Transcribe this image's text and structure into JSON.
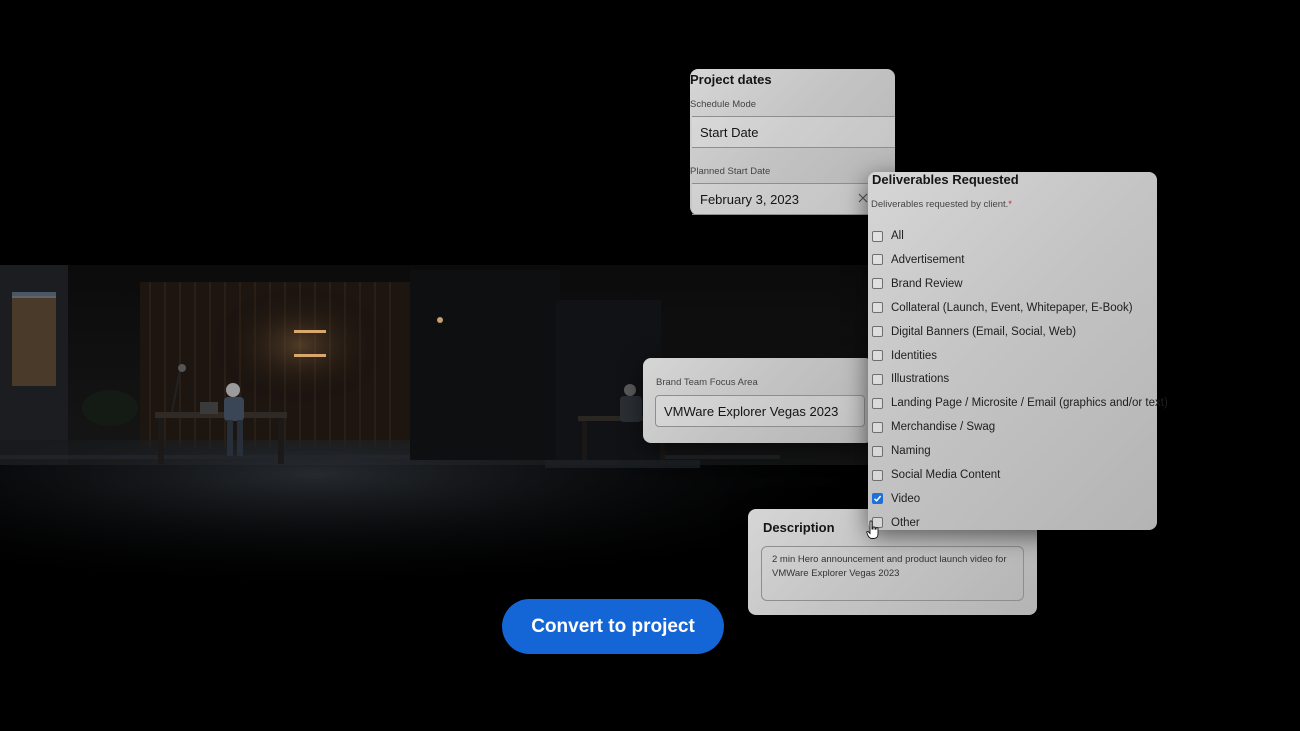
{
  "project_dates": {
    "title": "Project dates",
    "schedule_mode_label": "Schedule Mode",
    "schedule_mode_value": "Start Date",
    "planned_start_label": "Planned Start Date",
    "planned_start_value": "February 3, 2023",
    "clear_icon": "close-icon"
  },
  "deliverables": {
    "title": "Deliverables Requested",
    "subtitle": "Deliverables requested by client.",
    "required_marker": "*",
    "required_color": "#c9252c",
    "items": [
      {
        "label": "All",
        "checked": false
      },
      {
        "label": "Advertisement",
        "checked": false
      },
      {
        "label": "Brand Review",
        "checked": false
      },
      {
        "label": "Collateral (Launch, Event, Whitepaper, E-Book)",
        "checked": false
      },
      {
        "label": "Digital Banners (Email, Social, Web)",
        "checked": false
      },
      {
        "label": "Identities",
        "checked": false
      },
      {
        "label": "Illustrations",
        "checked": false
      },
      {
        "label": "Landing Page / Microsite / Email (graphics and/or text)",
        "checked": false
      },
      {
        "label": "Merchandise / Swag",
        "checked": false
      },
      {
        "label": "Naming",
        "checked": false
      },
      {
        "label": "Social Media Content",
        "checked": false
      },
      {
        "label": "Video",
        "checked": true
      },
      {
        "label": "Other",
        "checked": false
      }
    ]
  },
  "brand_team": {
    "label": "Brand Team Focus Area",
    "value": "VMWare Explorer Vegas 2023"
  },
  "description": {
    "title": "Description",
    "text": "2 min Hero announcement and product launch video for VMWare Explorer Vegas 2023"
  },
  "actions": {
    "convert_label": "Convert to project",
    "convert_color": "#1466d6"
  },
  "cursor_icon": "hand-pointer-icon"
}
